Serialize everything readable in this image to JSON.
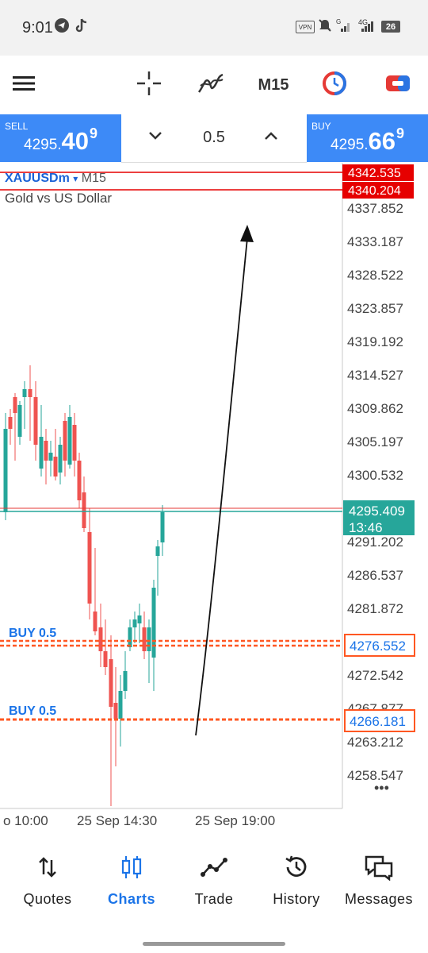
{
  "status_bar": {
    "time": "9:01",
    "vpn_badge": "VPN",
    "signal_1_label": "G",
    "signal_2_label": "4G",
    "battery": "26"
  },
  "toolbar": {
    "timeframe": "M15",
    "icons": [
      "menu-icon",
      "crosshair-icon",
      "indicators-icon",
      "timeframe",
      "one-click-trading-icon",
      "trade-panel-icon"
    ]
  },
  "trade_panel": {
    "sell_label": "SELL",
    "sell_price_small": "4295.",
    "sell_price_big": "40",
    "sell_price_sup": "9",
    "lot": "0.5",
    "buy_label": "BUY",
    "buy_price_small": "4295.",
    "buy_price_big": "66",
    "buy_price_sup": "9"
  },
  "chart": {
    "symbol": "XAUUSDm",
    "symbol_caret": "▾",
    "timeframe": "M15",
    "description": "Gold vs US Dollar",
    "alert_levels": [
      "4342.535",
      "4340.204"
    ],
    "price_labels": [
      "4337.852",
      "4333.187",
      "4328.522",
      "4323.857",
      "4319.192",
      "4314.527",
      "4309.862",
      "4305.197",
      "4300.532",
      "4291.202",
      "4286.537",
      "4281.872",
      "4272.542",
      "4267.877",
      "4263.212",
      "4258.547"
    ],
    "current_price": "4295.409",
    "countdown": "13:46",
    "orders": [
      {
        "label": "BUY 0.5",
        "price": "4276.552"
      },
      {
        "label": "BUY 0.5",
        "price": "4266.181"
      }
    ],
    "time_labels": [
      "o 10:00",
      "25 Sep 14:30",
      "25 Sep 19:00"
    ],
    "more_label": "•••",
    "colors": {
      "bull": "#26a69a",
      "bear": "#ef5350",
      "order": "#ff5722",
      "alert": "#e60000",
      "ask_line": "#e53935",
      "bid_line": "#26a69a"
    }
  },
  "bottom_nav": {
    "items": [
      {
        "label": "Quotes",
        "icon": "quotes-arrows-icon",
        "active": false
      },
      {
        "label": "Charts",
        "icon": "candles-icon",
        "active": true
      },
      {
        "label": "Trade",
        "icon": "trade-line-icon",
        "active": false
      },
      {
        "label": "History",
        "icon": "history-clock-icon",
        "active": false
      },
      {
        "label": "Messages",
        "icon": "messages-icon",
        "active": false
      }
    ]
  }
}
